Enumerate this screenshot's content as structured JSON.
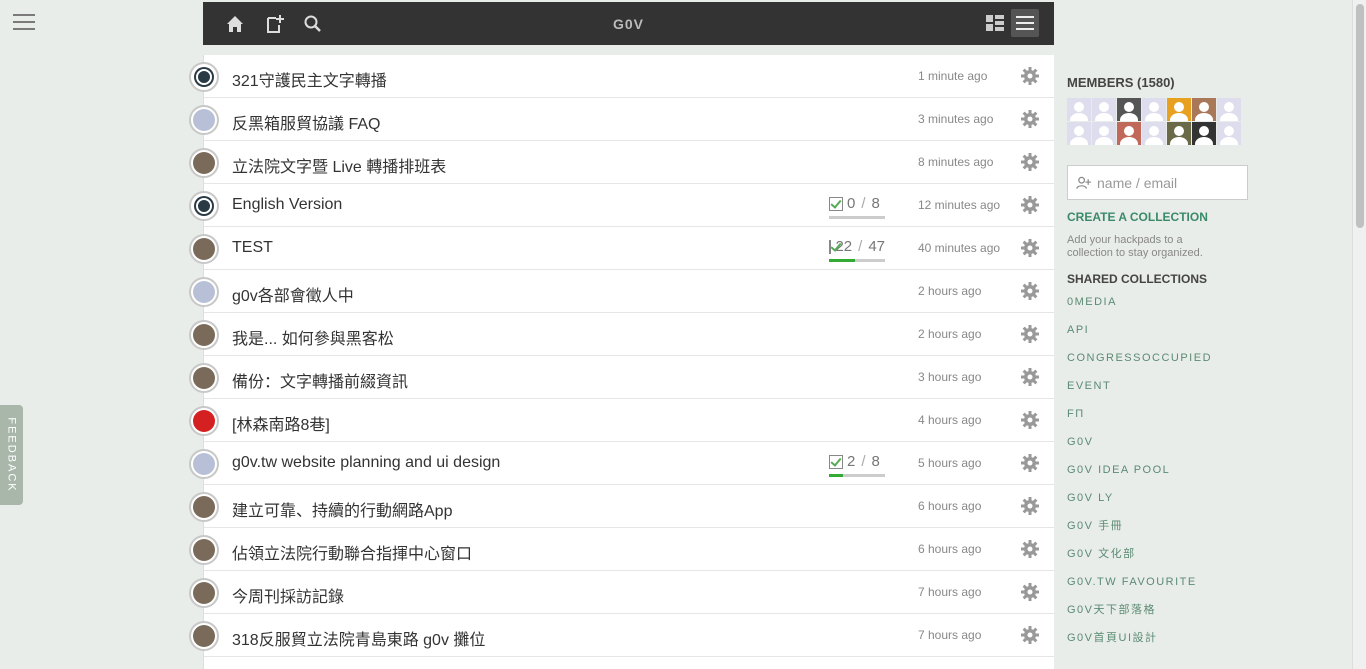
{
  "app": {
    "title": "G0V",
    "feedback_label": "FEEDBACK"
  },
  "icons": {
    "menu": "menu-icon",
    "home": "home-icon",
    "new_pad": "new-pad-icon",
    "search": "search-icon",
    "grid_view": "grid-view-icon",
    "list_view": "list-view-icon",
    "settings": "gear-icon",
    "add_user": "add-user-icon"
  },
  "pads": [
    {
      "title": "321守護民主文字轉播",
      "time": "1 minute ago",
      "avatar": "logo"
    },
    {
      "title": "反黑箱服貿協議 FAQ",
      "time": "3 minutes ago",
      "avatar": "default"
    },
    {
      "title": "立法院文字暨 Live 轉播排班表",
      "time": "8 minutes ago",
      "avatar": "photo"
    },
    {
      "title": "English Version",
      "time": "12 minutes ago",
      "avatar": "logo",
      "tasks_done": "0",
      "tasks_total": "8",
      "progress": 0
    },
    {
      "title": "TEST",
      "time": "40 minutes ago",
      "avatar": "photo",
      "tasks_done": "22",
      "tasks_total": "47",
      "progress": 0.47
    },
    {
      "title": "g0v各部會徵人中",
      "time": "2 hours ago",
      "avatar": "default"
    },
    {
      "title": "我是... 如何參與黑客松",
      "time": "2 hours ago",
      "avatar": "photo"
    },
    {
      "title": "備份：文字轉播前綴資訊",
      "time": "3 hours ago",
      "avatar": "photo"
    },
    {
      "title": "[林森南路8巷]",
      "time": "4 hours ago",
      "avatar": "red"
    },
    {
      "title": "g0v.tw website planning and ui design",
      "time": "5 hours ago",
      "avatar": "default",
      "tasks_done": "2",
      "tasks_total": "8",
      "progress": 0.25
    },
    {
      "title": "建立可靠、持續的行動網路App",
      "time": "6 hours ago",
      "avatar": "photo"
    },
    {
      "title": "佔領立法院行動聯合指揮中心窗口",
      "time": "6 hours ago",
      "avatar": "photo"
    },
    {
      "title": "今周刊採訪記錄",
      "time": "7 hours ago",
      "avatar": "photo"
    },
    {
      "title": "318反服貿立法院青島東路 g0v 攤位",
      "time": "7 hours ago",
      "avatar": "photo"
    }
  ],
  "sidebar": {
    "members_label": "MEMBERS (1580)",
    "invite_placeholder": "name / email",
    "create_label": "CREATE A COLLECTION",
    "create_desc": "Add your hackpads to a collection to stay organized.",
    "shared_label": "SHARED COLLECTIONS",
    "collections": [
      "0MEDIA",
      "API",
      "CONGRESSOCCUPIED",
      "EVENT",
      "FΠ",
      "G0V",
      "G0V IDEA POOL",
      "G0V LY",
      "G0V 手冊",
      "G0V 文化部",
      "G0V.TW FAVOURITE",
      "G0V天下部落格",
      "G0V首頁UI設計"
    ]
  },
  "colors": {
    "topbar": "#333333",
    "accent": "#3a8a6a",
    "progress": "#33aa33",
    "background": "#e9ede9"
  }
}
